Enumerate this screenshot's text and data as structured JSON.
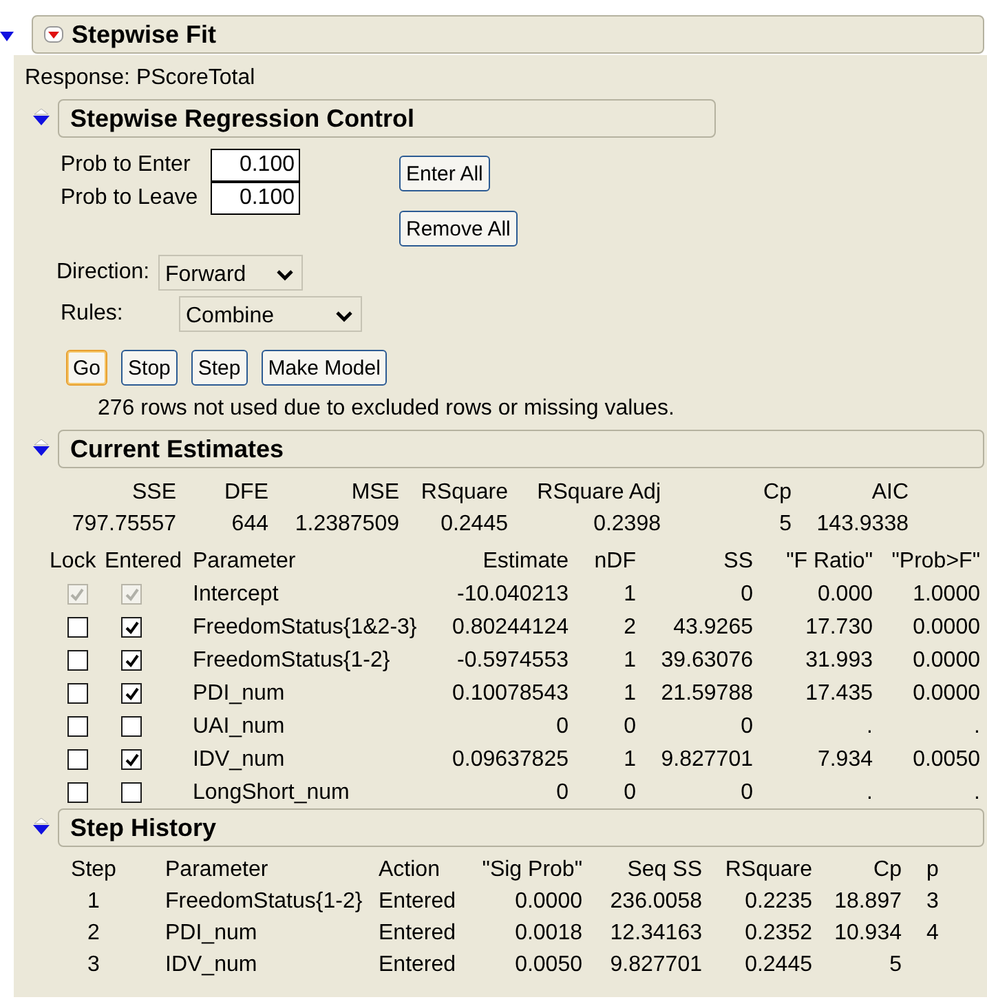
{
  "report": {
    "title": "Stepwise Fit",
    "expanded": true,
    "response": "Response: PScoreTotal"
  },
  "control": {
    "title": "Stepwise Regression Control",
    "expanded": true,
    "fields": [
      {
        "label": "Prob to Enter",
        "value": "0.100"
      },
      {
        "label": "Prob to Leave",
        "value": "0.100"
      }
    ],
    "dropdowns": [
      {
        "label": "Direction:",
        "value": "Forward"
      },
      {
        "label": "Rules:",
        "value": "Combine"
      }
    ],
    "side_buttons": [
      "Enter All",
      "Remove All"
    ],
    "buttons": [
      {
        "label": "Go",
        "default": true
      },
      {
        "label": "Stop",
        "default": false
      },
      {
        "label": "Step",
        "default": false
      },
      {
        "label": "Make Model",
        "default": false
      }
    ],
    "note": "276 rows not used due to excluded rows or missing values."
  },
  "estimates": {
    "title": "Current Estimates",
    "expanded": true,
    "summary_columns": [
      "SSE",
      "DFE",
      "MSE",
      "RSquare",
      "RSquare Adj",
      "Cp",
      "AIC"
    ],
    "summary_values": [
      "797.75557",
      "644",
      "1.2387509",
      "0.2445",
      "0.2398",
      "5",
      "143.9338"
    ],
    "check_columns": [
      "Lock",
      "Entered"
    ],
    "columns": [
      "Parameter",
      "Estimate",
      "nDF",
      "SS",
      "\"F Ratio\"",
      "\"Prob>F\""
    ],
    "rows": [
      {
        "lock": true,
        "entered": true,
        "disabled": true,
        "cells": [
          "Intercept",
          "-10.040213",
          "1",
          "0",
          "0.000",
          "1.0000"
        ]
      },
      {
        "lock": false,
        "entered": true,
        "disabled": false,
        "cells": [
          "FreedomStatus{1&2-3}",
          "0.80244124",
          "2",
          "43.9265",
          "17.730",
          "0.0000"
        ]
      },
      {
        "lock": false,
        "entered": true,
        "disabled": false,
        "cells": [
          "FreedomStatus{1-2}",
          "-0.5974553",
          "1",
          "39.63076",
          "31.993",
          "0.0000"
        ]
      },
      {
        "lock": false,
        "entered": true,
        "disabled": false,
        "cells": [
          "PDI_num",
          "0.10078543",
          "1",
          "21.59788",
          "17.435",
          "0.0000"
        ]
      },
      {
        "lock": false,
        "entered": false,
        "disabled": false,
        "cells": [
          "UAI_num",
          "0",
          "0",
          "0",
          ".",
          "."
        ]
      },
      {
        "lock": false,
        "entered": true,
        "disabled": false,
        "cells": [
          "IDV_num",
          "0.09637825",
          "1",
          "9.827701",
          "7.934",
          "0.0050"
        ]
      },
      {
        "lock": false,
        "entered": false,
        "disabled": false,
        "cells": [
          "LongShort_num",
          "0",
          "0",
          "0",
          ".",
          "."
        ]
      }
    ]
  },
  "history": {
    "title": "Step History",
    "expanded": true,
    "columns": [
      "Step",
      "Parameter",
      "Action",
      "\"Sig Prob\"",
      "Seq SS",
      "RSquare",
      "Cp",
      "p"
    ],
    "rows": [
      [
        "1",
        "FreedomStatus{1-2}",
        "Entered",
        "0.0000",
        "236.0058",
        "0.2235",
        "18.897",
        "3"
      ],
      [
        "2",
        "PDI_num",
        "Entered",
        "0.0018",
        "12.34163",
        "0.2352",
        "10.934",
        "4"
      ],
      [
        "3",
        "IDV_num",
        "Entered",
        "0.0050",
        "9.827701",
        "0.2445",
        "5"
      ]
    ]
  }
}
